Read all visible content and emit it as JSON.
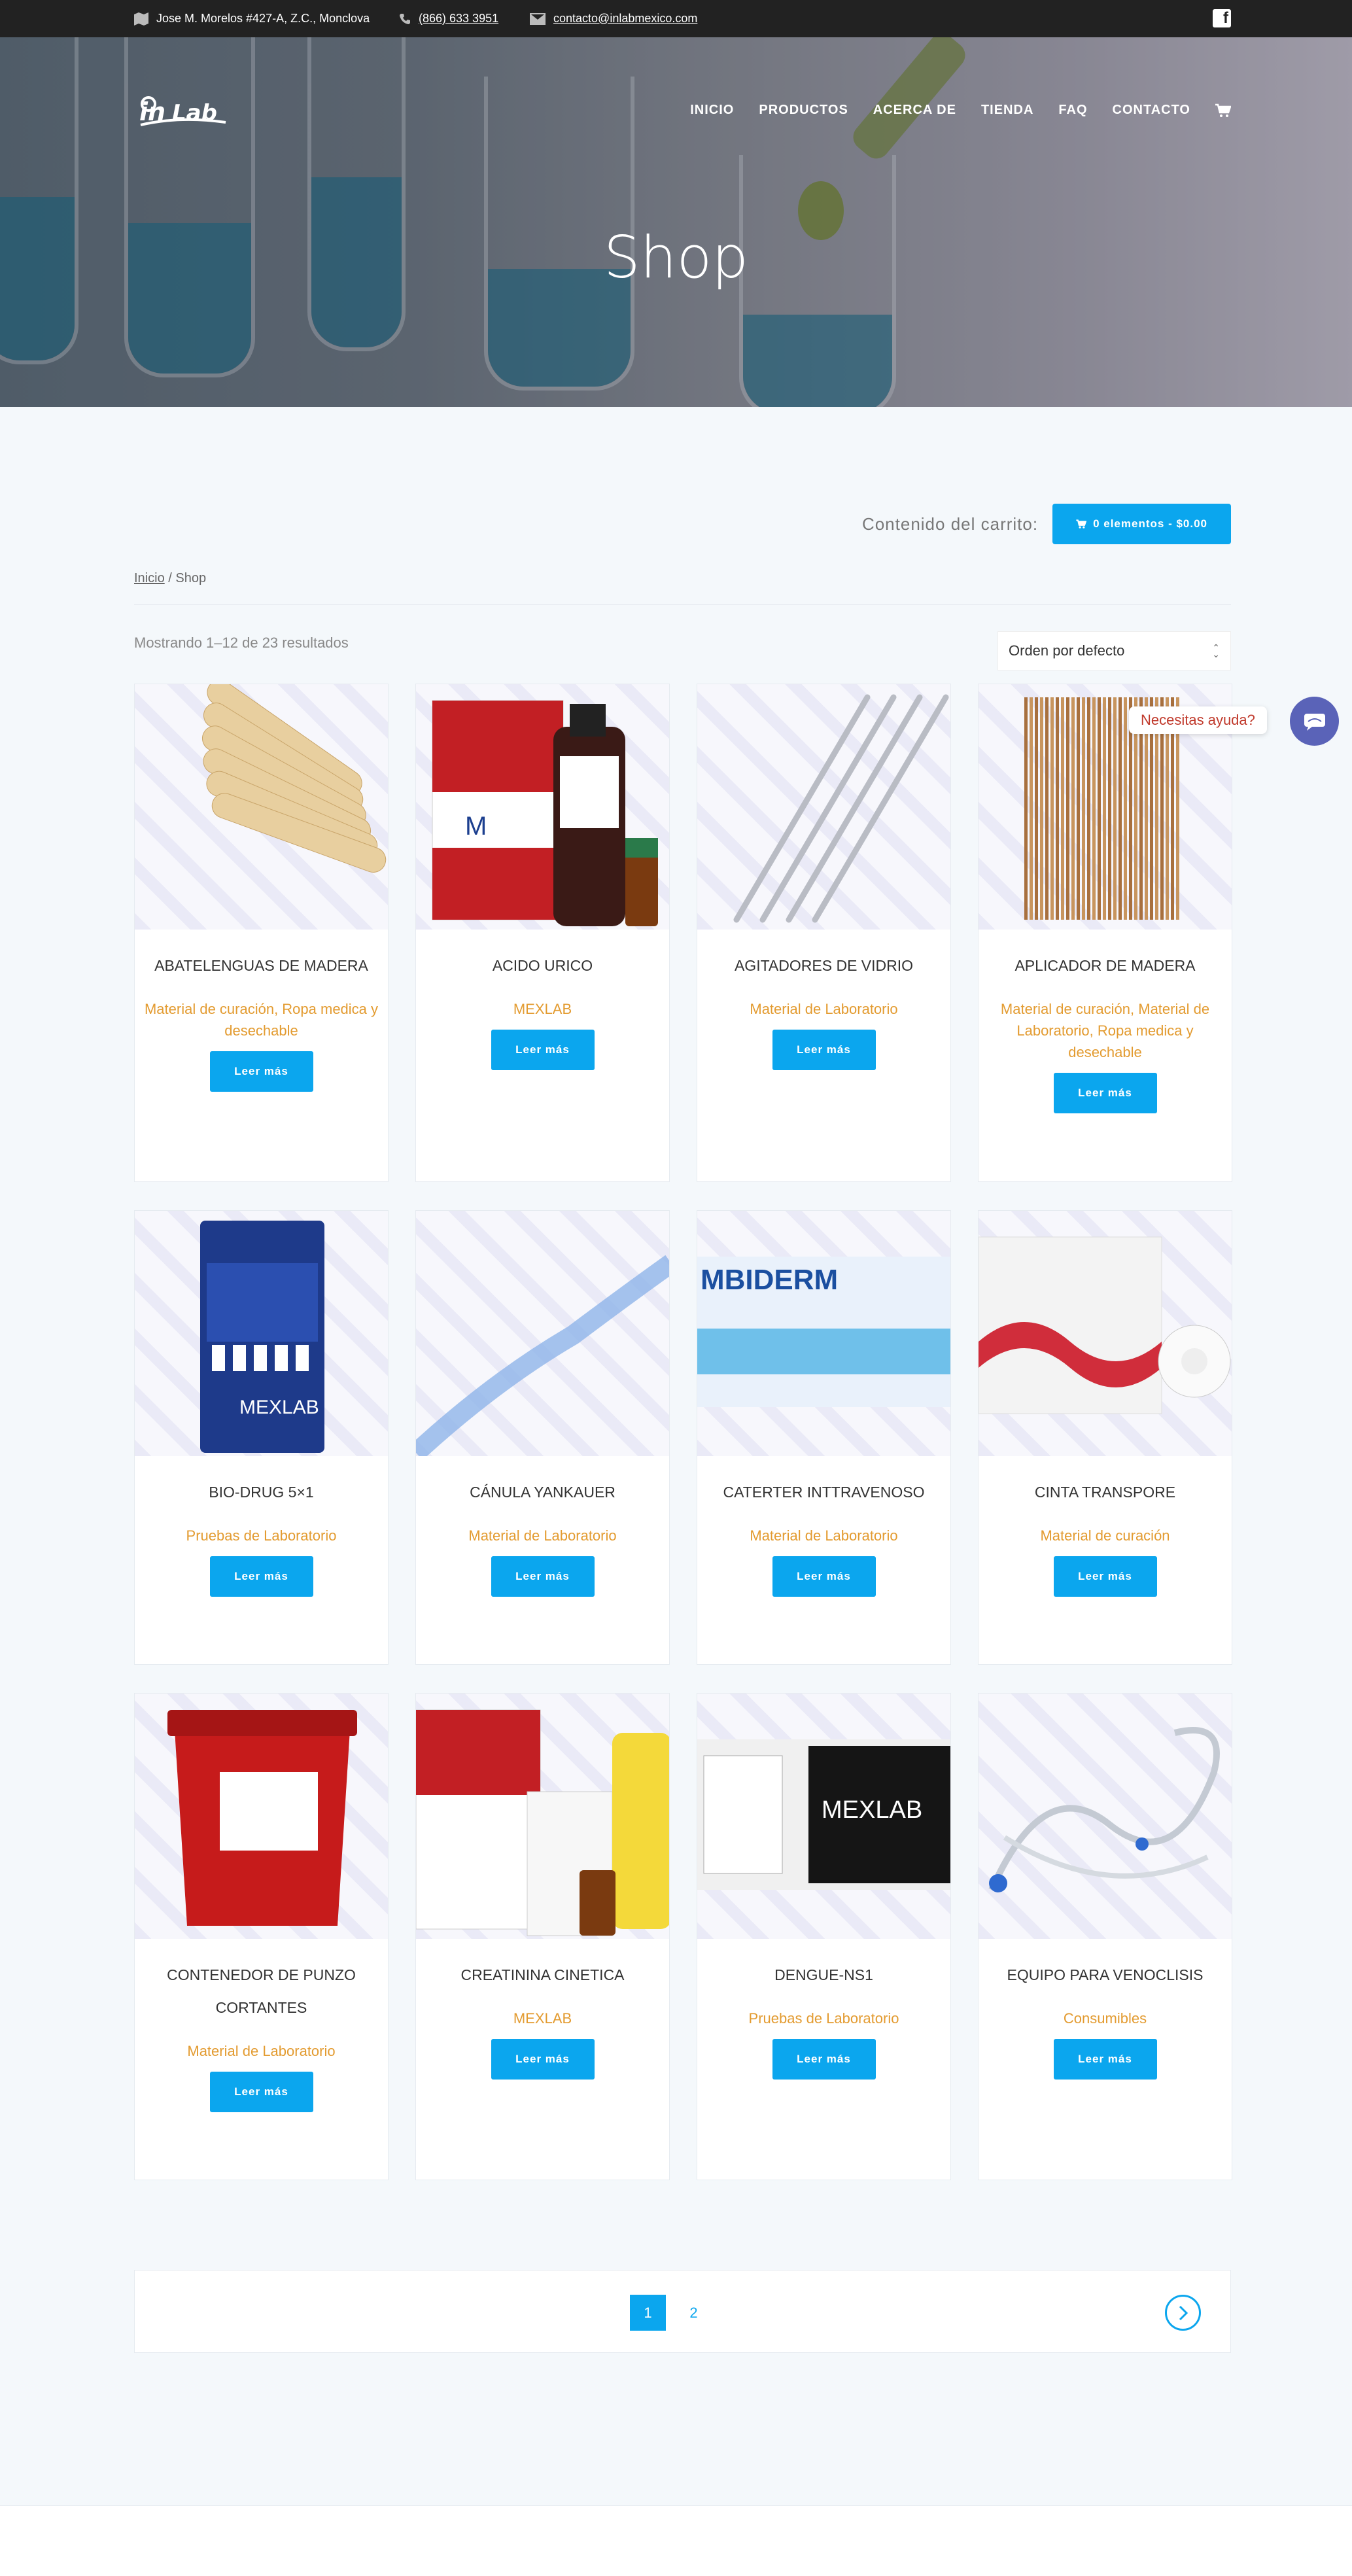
{
  "topbar": {
    "address": "Jose M. Morelos #427-A, Z.C., Monclova",
    "phone": "(866) 633 3951",
    "email": "contacto@inlabmexico.com"
  },
  "nav": {
    "items": [
      "INICIO",
      "PRODUCTOS",
      "ACERCA DE",
      "TIENDA",
      "FAQ",
      "CONTACTO"
    ]
  },
  "hero": {
    "title": "Shop"
  },
  "cart": {
    "label": "Contenido del carrito:",
    "button": "0 elementos - $0.00"
  },
  "breadcrumb": {
    "home": "Inicio",
    "separator": "/ Shop"
  },
  "results": "Mostrando 1–12 de 23 resultados",
  "order": {
    "selected": "Orden por defecto"
  },
  "products": [
    {
      "name": "ABATELENGUAS DE MADERA",
      "cat": "Material de curación, Ropa medica y desechable",
      "btn": "Leer más"
    },
    {
      "name": "ACIDO URICO",
      "cat": "MEXLAB",
      "btn": "Leer más"
    },
    {
      "name": "AGITADORES DE VIDRIO",
      "cat": "Material de Laboratorio",
      "btn": "Leer más"
    },
    {
      "name": "APLICADOR DE MADERA",
      "cat": "Material de curación, Material de Laboratorio, Ropa medica y desechable",
      "btn": "Leer más"
    },
    {
      "name": "BIO-DRUG 5×1",
      "cat": "Pruebas de Laboratorio",
      "btn": "Leer más"
    },
    {
      "name": "CÁNULA YANKAUER",
      "cat": "Material de Laboratorio",
      "btn": "Leer más"
    },
    {
      "name": "CATERTER INTTRAVENOSO",
      "cat": "Material de Laboratorio",
      "btn": "Leer más"
    },
    {
      "name": "CINTA TRANSPORE",
      "cat": "Material de curación",
      "btn": "Leer más"
    },
    {
      "name": "CONTENEDOR DE PUNZO CORTANTES",
      "cat": "Material de Laboratorio",
      "btn": "Leer más"
    },
    {
      "name": "CREATININA CINETICA",
      "cat": "MEXLAB",
      "btn": "Leer más"
    },
    {
      "name": "DENGUE-NS1",
      "cat": "Pruebas de Laboratorio",
      "btn": "Leer más"
    },
    {
      "name": "EQUIPO PARA VENOCLISIS",
      "cat": "Consumibles",
      "btn": "Leer más"
    }
  ],
  "pagination": {
    "current": "1",
    "next_page": "2"
  },
  "help": {
    "label": "Necesitas ayuda?"
  },
  "colors": {
    "accent": "#0ba6ee",
    "category": "#e39b30",
    "topbar": "#222222"
  }
}
